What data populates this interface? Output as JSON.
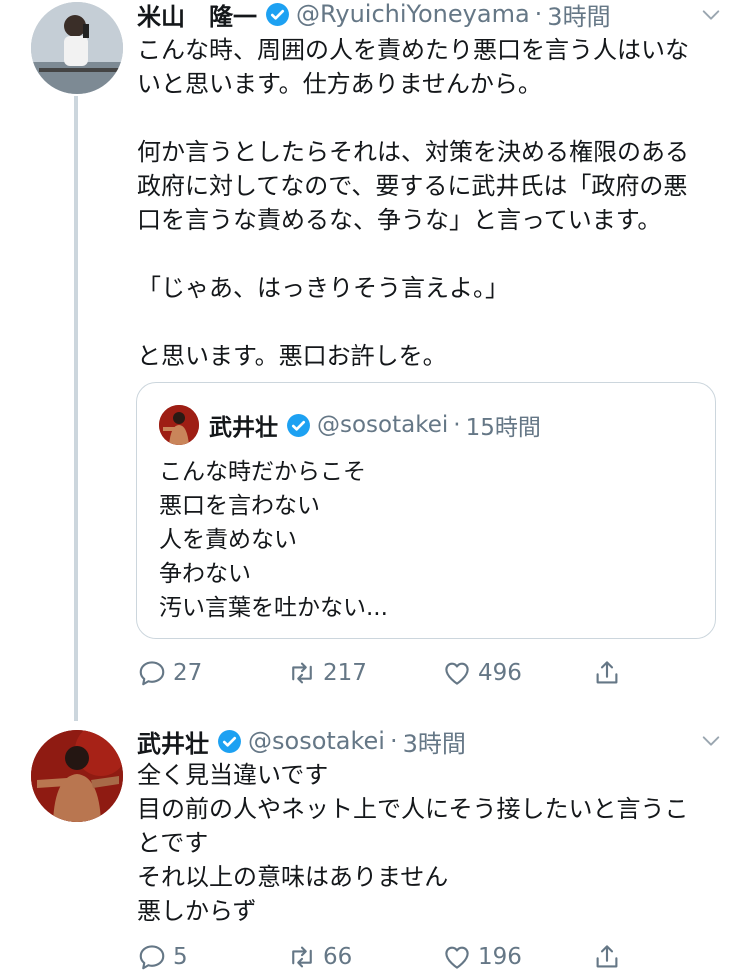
{
  "tweet1": {
    "name": "米山　隆一",
    "handle": "@RyuichiYoneyama",
    "separator": "·",
    "time": "3時間",
    "text": "こんな時、周囲の人を責めたり悪口を言う人はいな\nいと思います。仕方ありませんから。\n\n何か言うとしたらそれは、対策を決める権限のある\n政府に対してなので、要するに武井氏は「政府の悪\n口を言うな責めるな、争うな」と言っています。\n\n「じゃあ、はっきりそう言えよ。」\n\nと思います。悪口お許しを。",
    "quote": {
      "name": "武井壮",
      "handle": "@sosotakei",
      "separator": "·",
      "time": "15時間",
      "text": "こんな時だからこそ\n悪口を言わない\n人を責めない\n争わない\n汚い言葉を吐かない..."
    },
    "replies": "27",
    "retweets": "217",
    "likes": "496"
  },
  "tweet2": {
    "name": "武井壮",
    "handle": "@sosotakei",
    "separator": "·",
    "time": "3時間",
    "text": "全く見当違いです\n目の前の人やネット上で人にそう接したいと言うこ\nとです\nそれ以上の意味はありません\n悪しからず",
    "replies": "5",
    "retweets": "66",
    "likes": "196"
  },
  "colors": {
    "verified": "#1da1f2",
    "muted": "#657786",
    "border": "#ccd6dd"
  }
}
